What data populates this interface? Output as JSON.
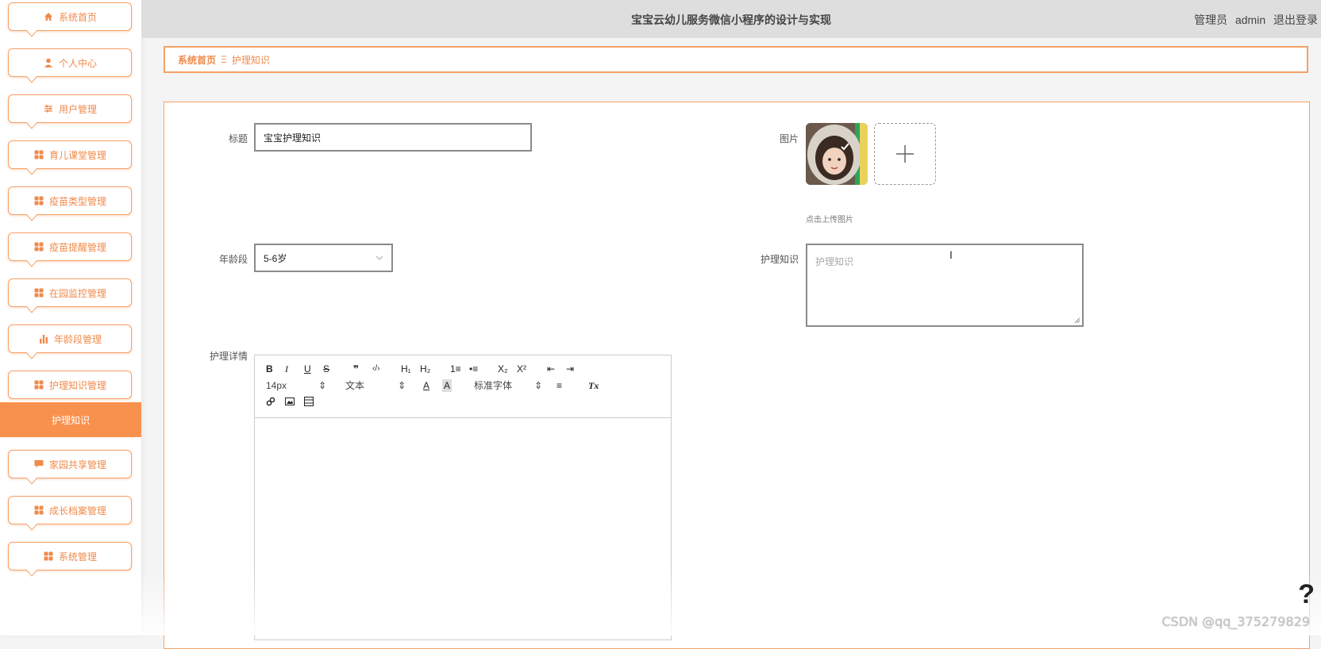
{
  "header": {
    "app_title": "宝宝云幼儿服务微信小程序的设计与实现",
    "user_role": "管理员",
    "username": "admin",
    "logout": "退出登录"
  },
  "sidebar": {
    "items": [
      {
        "label": "系统首页",
        "icon": "home-icon"
      },
      {
        "label": "个人中心",
        "icon": "user-icon"
      },
      {
        "label": "用户管理",
        "icon": "sliders-icon"
      },
      {
        "label": "育儿课堂管理",
        "icon": "grid-icon"
      },
      {
        "label": "疫苗类型管理",
        "icon": "grid-icon"
      },
      {
        "label": "疫苗提醒管理",
        "icon": "grid-icon"
      },
      {
        "label": "在园监控管理",
        "icon": "grid-icon"
      },
      {
        "label": "年龄段管理",
        "icon": "bar-chart-icon"
      },
      {
        "label": "护理知识管理",
        "icon": "grid-icon"
      },
      {
        "label": "家园共享管理",
        "icon": "message-icon"
      },
      {
        "label": "成长档案管理",
        "icon": "grid-icon"
      },
      {
        "label": "系统管理",
        "icon": "grid-icon"
      }
    ],
    "active_subitem": "护理知识"
  },
  "breadcrumb": {
    "home": "系统首页",
    "separator": "Ξ",
    "current": "护理知识"
  },
  "form": {
    "title_label": "标题",
    "title_value": "宝宝护理知识",
    "image_label": "图片",
    "upload_tip": "点击上传图片",
    "age_label": "年龄段",
    "age_value": "5-6岁",
    "knowledge_label": "护理知识",
    "knowledge_placeholder": "护理知识",
    "detail_label": "护理详情"
  },
  "editor": {
    "toolbar_row1": [
      "B",
      "I",
      "U",
      "S",
      "❞",
      "‹/›",
      "H₁",
      "H₂",
      "1≡",
      "•≡",
      "X₂",
      "X²",
      "⇤",
      "⇥"
    ],
    "font_size": "14px",
    "text_type": "文本",
    "font_family": "标准字体",
    "clear_format": "Tx"
  },
  "watermark": "CSDN @qq_375279829",
  "help_mark": "?",
  "colors": {
    "accent": "#f9914e",
    "border_accent": "#f5a168",
    "header_bg": "#dedede"
  }
}
